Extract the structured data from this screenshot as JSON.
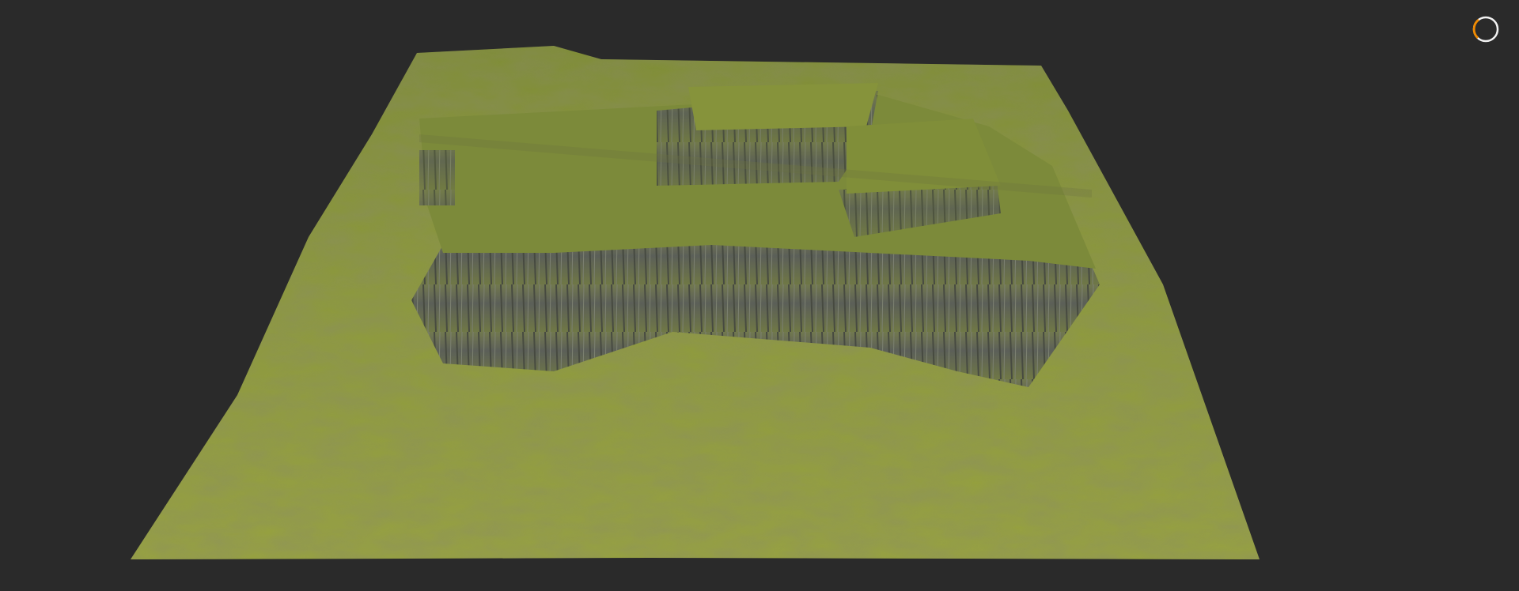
{
  "viewport": {
    "content": "3d-terrain-render",
    "background_color": "#2a2a2a"
  },
  "terrain": {
    "grass_color": "#8a9a3a",
    "rock_color": "#5c5e5c"
  },
  "loading_indicator": {
    "state": "loading",
    "accent_color": "#f08a00",
    "ring_color": "#f2f2f2"
  }
}
